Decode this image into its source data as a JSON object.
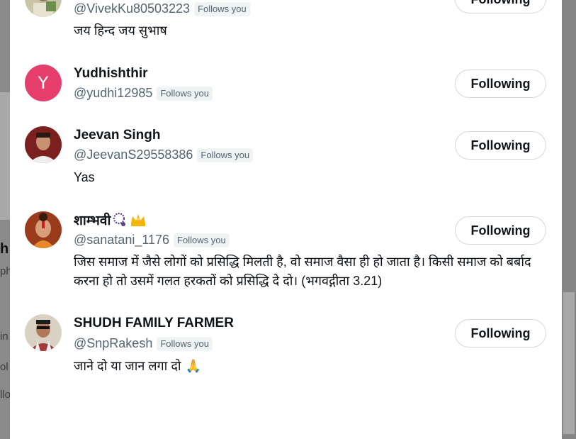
{
  "background_page": {
    "snippets": [
      "h",
      "ph",
      "in",
      "ol",
      "llo"
    ]
  },
  "users": [
    {
      "name": "",
      "handle": "@VivekKu80503223",
      "follows_you": "Follows you",
      "bio": "जय हिन्द जय सुभाष",
      "button": "Following"
    },
    {
      "name": "Yudhishthir",
      "handle": "@yudhi12985",
      "follows_you": "Follows you",
      "bio": "",
      "button": "Following",
      "avatar_letter": "Y",
      "avatar_color": "#e63f6d"
    },
    {
      "name": "Jeevan Singh",
      "handle": "@JeevanS29558386",
      "follows_you": "Follows you",
      "bio": "Yas",
      "button": "Following"
    },
    {
      "name": "शाम्भवी",
      "handle": "@sanatani_1176",
      "follows_you": "Follows you",
      "bio": "जिस समाज में जैसे लोगों को प्रसिद्धि मिलती है, वो समाज वैसा ही हो जाता है। किसी समाज को बर्बाद करना हो तो उसमें गलत हरकतों को प्रसिद्धि दे दो। (भगवद्गीता 3.21)",
      "button": "Following",
      "name_emojis": [
        "prayer-beads-icon",
        "crown-icon"
      ]
    },
    {
      "name": "SHUDH FAMILY FARMER",
      "handle": "@SnpRakesh",
      "follows_you": "Follows you",
      "bio": "जाने दो या जान लगा दो",
      "button": "Following",
      "bio_emoji": "🙏"
    }
  ]
}
